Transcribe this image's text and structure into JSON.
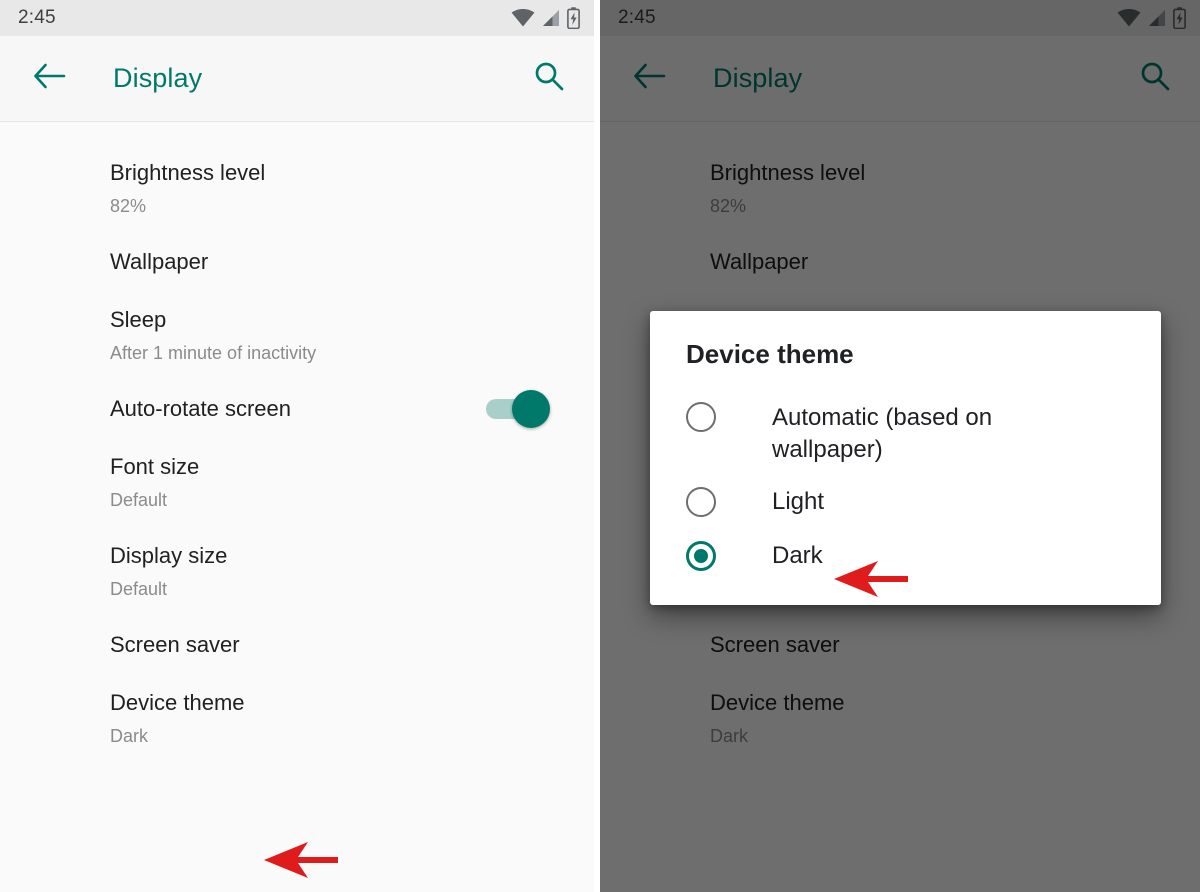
{
  "statusbar": {
    "time": "2:45",
    "icons": [
      "wifi-icon",
      "cellular-signal-icon",
      "battery-charging-icon"
    ]
  },
  "actionbar": {
    "back_label": "back-arrow-icon",
    "title": "Display",
    "search_label": "search-icon",
    "accent_color": "#00796b"
  },
  "settings": [
    {
      "title": "Brightness level",
      "sub": "82%"
    },
    {
      "title": "Wallpaper",
      "sub": ""
    },
    {
      "title": "Sleep",
      "sub": "After 1 minute of inactivity"
    },
    {
      "title": "Auto-rotate screen",
      "sub": "",
      "switch": "on"
    },
    {
      "title": "Font size",
      "sub": "Default"
    },
    {
      "title": "Display size",
      "sub": "Default"
    },
    {
      "title": "Screen saver",
      "sub": ""
    },
    {
      "title": "Device theme",
      "sub": "Dark"
    }
  ],
  "dialog": {
    "title": "Device theme",
    "options": [
      {
        "label": "Automatic (based on wallpaper)",
        "selected": false
      },
      {
        "label": "Light",
        "selected": false
      },
      {
        "label": "Dark",
        "selected": true
      }
    ],
    "selected_value": "Dark",
    "radio_checked_color": "#00796b"
  },
  "annotations": {
    "arrow_color": "#e01b1b",
    "left_arrow_target": "Device theme",
    "right_arrow_target": "Dark"
  }
}
